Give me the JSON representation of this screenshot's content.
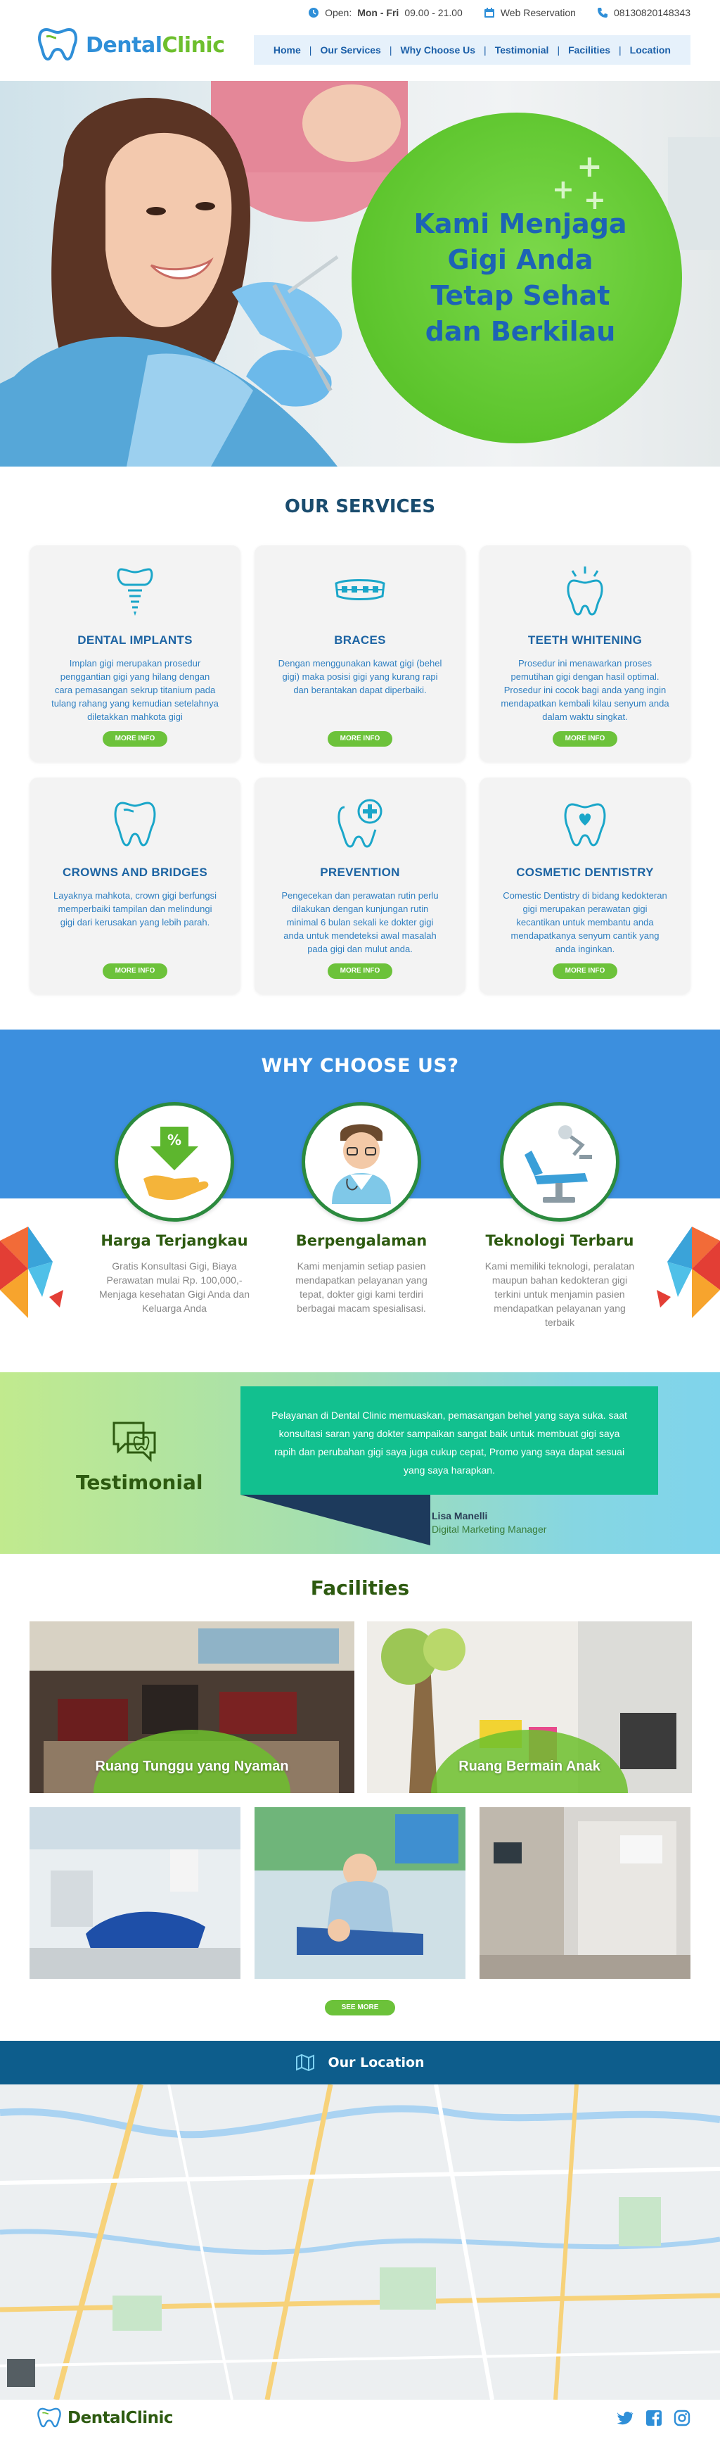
{
  "header": {
    "logo_part1": "Dental",
    "logo_part2": "Clinic",
    "hours_prefix": "Open:",
    "hours_days": "Mon - Fri",
    "hours_time": "09.00 - 21.00",
    "web_reservation": "Web Reservation",
    "phone": "08130820148343"
  },
  "nav": {
    "items": [
      "Home",
      "Our Services",
      "Why Choose Us",
      "Testimonial",
      "Facilities",
      "Location"
    ]
  },
  "hero": {
    "line1": "Kami Menjaga",
    "line2": "Gigi Anda",
    "line3": "Tetap Sehat",
    "line4": "dan Berkilau"
  },
  "services": {
    "title": "OUR SERVICES",
    "more_label": "MORE INFO",
    "items": [
      {
        "name": "DENTAL IMPLANTS",
        "icon": "implant-icon",
        "desc": "Implan gigi merupakan prosedur penggantian gigi yang hilang dengan cara pemasangan sekrup titanium pada tulang rahang yang kemudian setelahnya diletakkan mahkota gigi"
      },
      {
        "name": "BRACES",
        "icon": "braces-icon",
        "desc": "Dengan menggunakan kawat gigi (behel gigi) maka posisi gigi yang kurang rapi dan berantakan dapat diperbaiki."
      },
      {
        "name": "TEETH WHITENING",
        "icon": "whitening-icon",
        "desc": "Prosedur ini menawarkan proses pemutihan gigi dengan hasil optimal. Prosedur ini cocok bagi anda yang ingin mendapatkan kembali kilau senyum anda dalam waktu singkat."
      },
      {
        "name": "CROWNS AND BRIDGES",
        "icon": "crown-icon",
        "desc": "Layaknya mahkota, crown gigi berfungsi memperbaiki tampilan dan melindungi gigi dari kerusakan yang lebih parah."
      },
      {
        "name": "PREVENTION",
        "icon": "prevention-icon",
        "desc": "Pengecekan  dan perawatan rutin perlu dilakukan dengan kunjungan rutin minimal 6 bulan sekali ke dokter gigi anda untuk mendeteksi awal masalah pada gigi dan mulut anda."
      },
      {
        "name": "COSMETIC DENTISTRY",
        "icon": "cosmetic-icon",
        "desc": "Comestic Dentistry di bidang kedokteran gigi merupakan perawatan gigi kecantikan untuk membantu anda mendapatkanya senyum cantik yang anda inginkan."
      }
    ]
  },
  "why": {
    "title": "WHY CHOOSE US?",
    "items": [
      {
        "name": "Harga Terjangkau",
        "icon": "discount-hand-icon",
        "desc": "Gratis Konsultasi Gigi, Biaya Perawatan mulai Rp. 100,000,- Menjaga kesehatan Gigi Anda dan Keluarga Anda"
      },
      {
        "name": "Berpengalaman",
        "icon": "dentist-icon",
        "desc": "Kami menjamin setiap pasien mendapatkan pelayanan yang tepat, dokter gigi kami terdiri berbagai macam spesialisasi."
      },
      {
        "name": "Teknologi Terbaru",
        "icon": "dental-chair-icon",
        "desc": "Kami memiliki teknologi, peralatan maupun bahan kedokteran gigi terkini untuk menjamin pasien mendapatkan pelayanan yang terbaik"
      }
    ]
  },
  "testimonial": {
    "label": "Testimonial",
    "quote": "Pelayanan di Dental Clinic memuaskan, pemasangan behel yang saya suka. saat konsultasi saran yang dokter sampaikan sangat baik untuk membuat gigi saya rapih dan perubahan gigi saya juga cukup cepat, Promo yang saya dapat sesuai yang saya harapkan.",
    "name": "Lisa Manelli",
    "role": "Digital Marketing Manager"
  },
  "facilities": {
    "title": "Facilities",
    "captions": [
      "Ruang Tunggu yang Nyaman",
      "Ruang Bermain Anak"
    ],
    "see_more": "SEE MORE"
  },
  "location": {
    "title": "Our Location"
  },
  "footer": {
    "logo_part1": "Dental",
    "logo_part2": "Clinic",
    "social": [
      "twitter-icon",
      "facebook-icon",
      "instagram-icon"
    ]
  },
  "colors": {
    "brand_blue": "#2f8fd8",
    "brand_green": "#6dbf2d",
    "why_blue": "#3c8fde",
    "testimonial_green": "#12c08f",
    "location_bar": "#0d5d8c"
  }
}
